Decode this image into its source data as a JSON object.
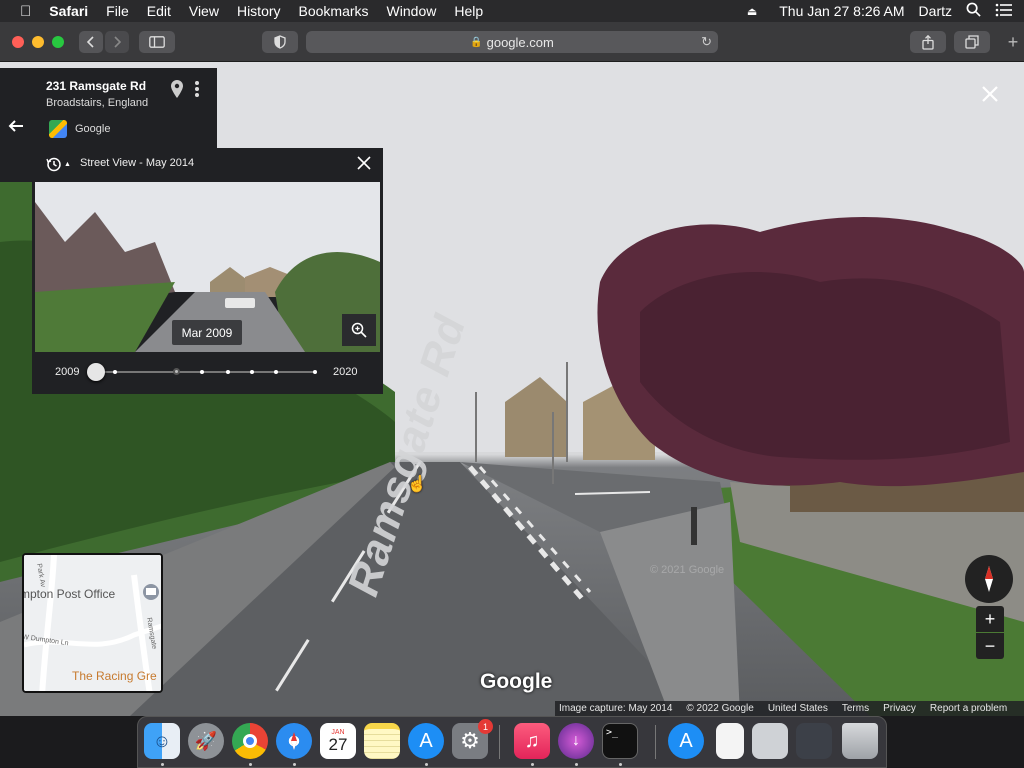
{
  "menubar": {
    "apple": "",
    "app": "Safari",
    "items": [
      "File",
      "Edit",
      "View",
      "History",
      "Bookmarks",
      "Window",
      "Help"
    ],
    "clock": "Thu Jan 27  8:26 AM",
    "user": "Dartz"
  },
  "browser": {
    "url": "google.com"
  },
  "place": {
    "title": "231 Ramsgate Rd",
    "subtitle": "Broadstairs, England",
    "brand": "Google"
  },
  "timeline": {
    "header": "Street View - May 2014",
    "preview_date": "Mar 2009",
    "start_year": "2009",
    "end_year": "2020",
    "selected_fraction": 0.0
  },
  "scene": {
    "road_label": "Ramsgate Rd",
    "watermark": "Google",
    "watermark_faint": "© 2021 Google"
  },
  "minimap": {
    "labels": [
      "mpton Post Office",
      "The Racing Gre",
      "W Dumpton Ln",
      "Park Av",
      "Ramsgate"
    ]
  },
  "footer": {
    "capture": "Image capture: May 2014",
    "copyright": "© 2022 Google",
    "region": "United States",
    "terms": "Terms",
    "privacy": "Privacy",
    "report": "Report a problem"
  },
  "dock": {
    "calendar_month": "JAN",
    "calendar_day": "27",
    "badge": "1"
  }
}
